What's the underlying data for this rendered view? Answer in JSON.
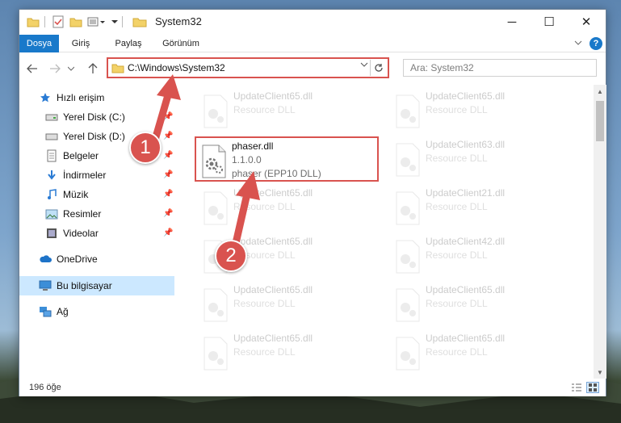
{
  "window": {
    "title": "System32",
    "controls": {
      "minimize": "─",
      "maximize": "☐",
      "close": "✕"
    }
  },
  "ribbon": {
    "tabs": [
      {
        "label": "Dosya",
        "active": true
      },
      {
        "label": "Giriş"
      },
      {
        "label": "Paylaş"
      },
      {
        "label": "Görünüm"
      }
    ],
    "expand_icon": "chevron-down-icon",
    "help_label": "?"
  },
  "address": {
    "path": "C:\\Windows\\System32",
    "search_placeholder": "Ara: System32"
  },
  "nav": {
    "quick_access": "Hızlı erişim",
    "items": [
      {
        "label": "Yerel Disk (C:)",
        "icon": "drive-icon",
        "pinned": true
      },
      {
        "label": "Yerel Disk (D:)",
        "icon": "drive-icon",
        "pinned": true
      },
      {
        "label": "Belgeler",
        "icon": "documents-icon",
        "pinned": true
      },
      {
        "label": "İndirmeler",
        "icon": "download-icon",
        "pinned": true
      },
      {
        "label": "Müzik",
        "icon": "music-icon",
        "pinned": true
      },
      {
        "label": "Resimler",
        "icon": "pictures-icon",
        "pinned": true
      },
      {
        "label": "Videolar",
        "icon": "video-icon",
        "pinned": true
      }
    ],
    "onedrive": "OneDrive",
    "this_pc": "Bu bilgisayar",
    "network": "Ağ"
  },
  "files": {
    "highlighted": {
      "name": "phaser.dll",
      "version": "1.1.0.0",
      "description": "phaser (EPP10 DLL)"
    },
    "left_column": [
      {
        "name": "UpdateClient65.dll",
        "type": "Resource DLL"
      },
      {
        "name": "UpdateClient65.dll",
        "type": "Resource DLL"
      },
      {
        "name": "UpdateClient65.dll",
        "type": "Resource DLL"
      },
      {
        "name": "UpdateClient65.dll",
        "type": "Resource DLL"
      },
      {
        "name": "UpdateClient65.dll",
        "type": "Resource DLL"
      }
    ],
    "right_column": [
      {
        "name": "UpdateClient65.dll",
        "type": "Resource DLL"
      },
      {
        "name": "UpdateClient63.dll",
        "type": "Resource DLL"
      },
      {
        "name": "UpdateClient21.dll",
        "type": "Resource DLL"
      },
      {
        "name": "UpdateClient42.dll",
        "type": "Resource DLL"
      },
      {
        "name": "UpdateClient65.dll",
        "type": "Resource DLL"
      },
      {
        "name": "UpdateClient65.dll",
        "type": "Resource DLL"
      }
    ]
  },
  "status": {
    "count": "196 öğe"
  },
  "annotations": {
    "step1": "1",
    "step2": "2",
    "color": "#d9534f"
  },
  "colors": {
    "accent": "#1979ca",
    "highlight": "#d9534f",
    "selection": "#cce8ff"
  }
}
